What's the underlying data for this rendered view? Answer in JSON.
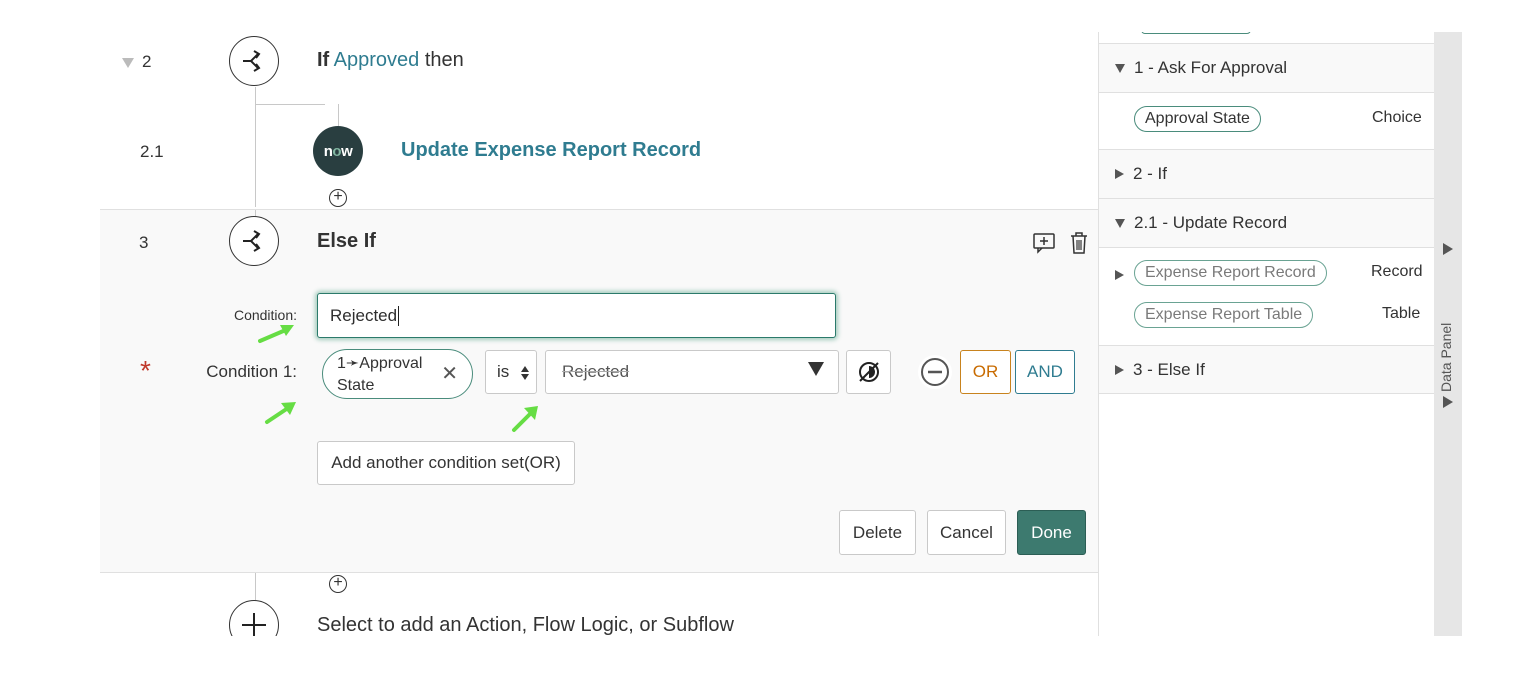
{
  "flow": {
    "step2": {
      "number": "2",
      "if_label": "If",
      "condition_pill": "Approved",
      "then_label": "then"
    },
    "step2_1": {
      "number": "2.1",
      "logo_text_n": "n",
      "logo_text_o": "o",
      "logo_text_w": "w",
      "action_label": "Update Expense Report Record"
    },
    "step3": {
      "number": "3",
      "title": "Else If"
    },
    "add_step_label": "Select to add an Action, Flow Logic, or Subflow"
  },
  "editor": {
    "condition_label": "Condition:",
    "condition_value": "Rejected",
    "required_marker": "*",
    "condition1_label": "Condition 1:",
    "field_pill_line1": "1➛Approval",
    "field_pill_line2": "State",
    "operator": "is",
    "value_placeholder": "Rejected",
    "or_label": "OR",
    "and_label": "AND",
    "add_condition_set_label": "Add another condition set(OR)",
    "delete_label": "Delete",
    "cancel_label": "Cancel",
    "done_label": "Done"
  },
  "data_panel": {
    "sections": [
      {
        "label": "1 - Ask For Approval",
        "expanded": true
      },
      {
        "label": "2 - If",
        "expanded": false
      },
      {
        "label": "2.1 - Update Record",
        "expanded": true
      },
      {
        "label": "3 - Else If",
        "expanded": false
      }
    ],
    "ask_for_approval_fields": [
      {
        "name": "Approval State",
        "type": "Choice"
      }
    ],
    "update_record_fields": [
      {
        "name": "Expense Report Record",
        "type": "Record"
      },
      {
        "name": "Expense Report Table",
        "type": "Table"
      }
    ],
    "tab_label": "Data Panel"
  },
  "colors": {
    "accent_teal": "#2f7c90",
    "done_green": "#3d7a6f",
    "required_red": "#c0392b",
    "or_orange": "#c86b00",
    "hint_arrow": "#66dd44"
  }
}
